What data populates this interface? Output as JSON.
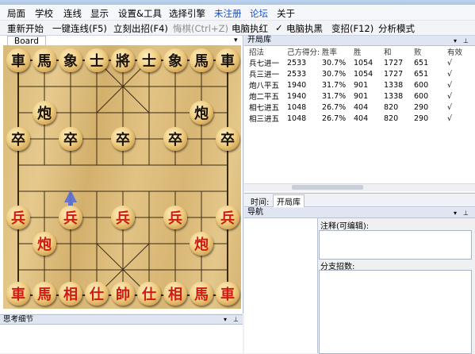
{
  "menu": [
    "局面",
    "学校",
    "连线",
    "显示",
    "设置&工具",
    "选择引擎",
    "未注册",
    "论坛",
    "关于"
  ],
  "toolbar": {
    "restart": "重新开始",
    "connect": "一键连线(F5)",
    "move_now": "立刻出招(F4)",
    "undo": "悔棋(Ctrl+Z)",
    "pc_red": "电脑执红",
    "pc_black_check": "✓",
    "pc_black": "电脑执黑",
    "change_move": "变招(F12)",
    "analysis": "分析模式"
  },
  "board_tab": "Board",
  "pieces": {
    "black_back": [
      "車",
      "馬",
      "象",
      "士",
      "將",
      "士",
      "象",
      "馬",
      "車"
    ],
    "black_cannon": "炮",
    "black_pawn": "卒",
    "red_pawn": "兵",
    "red_cannon": "炮",
    "red_back": [
      "車",
      "馬",
      "相",
      "仕",
      "帥",
      "仕",
      "相",
      "馬",
      "車"
    ]
  },
  "opening_book": {
    "title": "开局库",
    "columns": [
      "招法",
      "己方得分:",
      "胜率",
      "胜",
      "和",
      "败",
      "有效"
    ],
    "rows": [
      [
        "兵七进一",
        "2533",
        "30.7%",
        "1054",
        "1727",
        "651",
        "√"
      ],
      [
        "兵三进一",
        "2533",
        "30.7%",
        "1054",
        "1727",
        "651",
        "√"
      ],
      [
        "炮八平五",
        "1940",
        "31.7%",
        "901",
        "1338",
        "600",
        "√"
      ],
      [
        "炮二平五",
        "1940",
        "31.7%",
        "901",
        "1338",
        "600",
        "√"
      ],
      [
        "相七进五",
        "1048",
        "26.7%",
        "404",
        "820",
        "290",
        "√"
      ],
      [
        "相三进五",
        "1048",
        "26.7%",
        "404",
        "820",
        "290",
        "√"
      ]
    ]
  },
  "tabs": [
    "时间:",
    "开局库"
  ],
  "navigation": {
    "title": "导航",
    "note_label": "注释(可编辑):",
    "branch_label": "分支招数:"
  },
  "thinking": {
    "title": "思考细节"
  },
  "colors": {
    "red_piece": "#d01b10",
    "black_piece": "#1a1208",
    "board": "#dcbc7c",
    "arrow": "#5a6fd6",
    "accent": "#1b4fc4"
  }
}
